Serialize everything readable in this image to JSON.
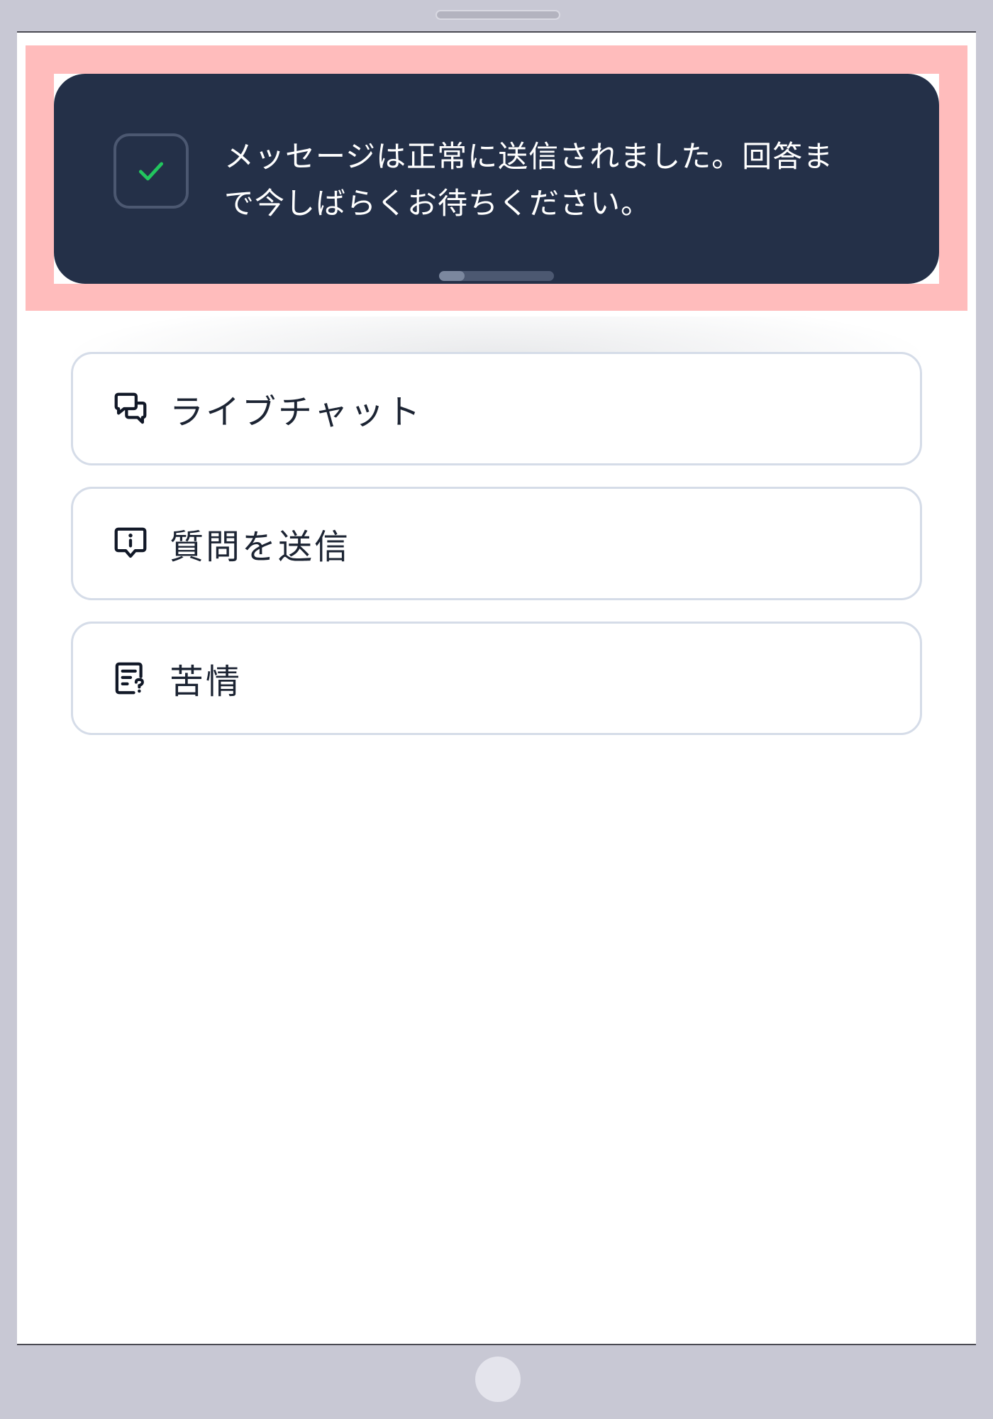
{
  "toast": {
    "message_line1": "メッセージは正常に送信されました。回答ま",
    "message_line2": "で今しばらくお待ちください。",
    "icon": "check-icon",
    "progress": 0.22,
    "colors": {
      "background": "#243048",
      "check": "#22c55e",
      "highlight": "#ffbcbc"
    }
  },
  "menu": {
    "items": [
      {
        "label": "ライブチャット",
        "icon": "chat-bubbles-icon"
      },
      {
        "label": "質問を送信",
        "icon": "info-message-icon"
      },
      {
        "label": "苦情",
        "icon": "document-question-icon"
      }
    ]
  }
}
